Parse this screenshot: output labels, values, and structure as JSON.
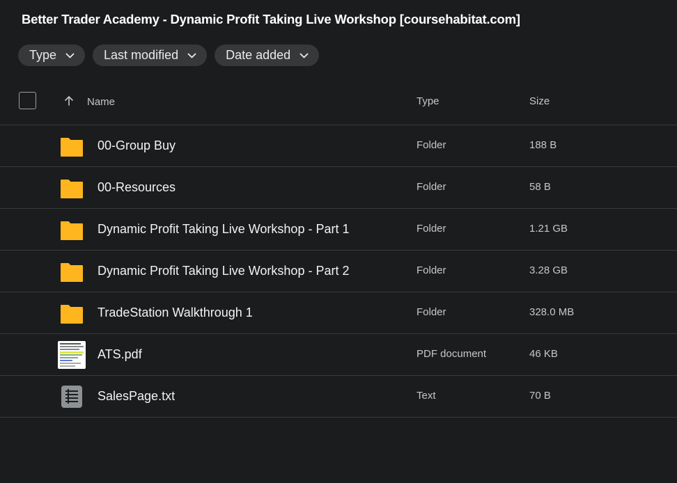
{
  "title": "Better Trader Academy - Dynamic Profit Taking Live Workshop [coursehabitat.com]",
  "filters": [
    {
      "label": "Type"
    },
    {
      "label": "Last modified"
    },
    {
      "label": "Date added"
    }
  ],
  "columns": {
    "name": "Name",
    "type": "Type",
    "size": "Size"
  },
  "files": [
    {
      "name": "00-Group Buy",
      "type": "Folder",
      "size": "188 B",
      "icon": "folder-icon"
    },
    {
      "name": "00-Resources",
      "type": "Folder",
      "size": "58 B",
      "icon": "folder-icon"
    },
    {
      "name": "Dynamic Profit Taking Live Workshop - Part 1",
      "type": "Folder",
      "size": "1.21 GB",
      "icon": "folder-icon"
    },
    {
      "name": "Dynamic Profit Taking Live Workshop - Part 2",
      "type": "Folder",
      "size": "3.28 GB",
      "icon": "folder-icon"
    },
    {
      "name": "TradeStation Walkthrough 1",
      "type": "Folder",
      "size": "328.0 MB",
      "icon": "folder-icon"
    },
    {
      "name": "ATS.pdf",
      "type": "PDF document",
      "size": "46 KB",
      "icon": "pdf-thumbnail"
    },
    {
      "name": "SalesPage.txt",
      "type": "Text",
      "size": "70 B",
      "icon": "text-file-icon"
    }
  ],
  "colors": {
    "background": "#1b1c1d",
    "chip": "#37383a",
    "folder": "#ffb61e",
    "divider": "#3a3b3d"
  }
}
